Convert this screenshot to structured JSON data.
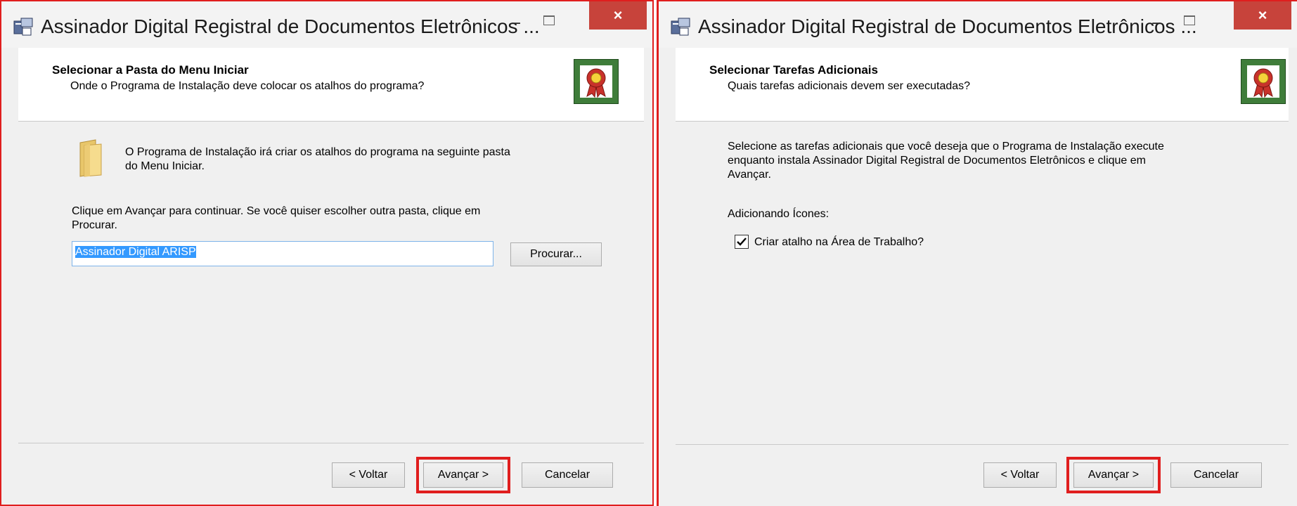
{
  "left_window": {
    "title": "Assinador Digital Registral de Documentos Eletrônicos ...",
    "controls": {
      "minimize": "−",
      "close": "×"
    },
    "header": {
      "title": "Selecionar a Pasta do Menu Iniciar",
      "subtitle": "Onde o Programa de Instalação deve colocar os atalhos do programa?"
    },
    "info_line1": "O Programa de Instalação irá criar os atalhos do programa na seguinte pasta",
    "info_line2": "do Menu Iniciar.",
    "instruction_line1": "Clique em Avançar para continuar. Se você quiser escolher outra pasta, clique em",
    "instruction_line2": "Procurar.",
    "folder_input_value": "Assinador Digital ARISP",
    "browse_label": "Procurar...",
    "back_label": "< Voltar",
    "next_label": "Avançar >",
    "cancel_label": "Cancelar"
  },
  "right_window": {
    "title": "Assinador Digital Registral de Documentos Eletrônicos ...",
    "controls": {
      "minimize": "−",
      "close": "×"
    },
    "header": {
      "title": "Selecionar Tarefas Adicionais",
      "subtitle": "Quais tarefas adicionais devem ser executadas?"
    },
    "desc_line1": "Selecione as tarefas adicionais que você deseja que o Programa de Instalação execute",
    "desc_line2": "enquanto instala Assinador Digital Registral de Documentos Eletrônicos e clique em",
    "desc_line3": "Avançar.",
    "group_label": "Adicionando Ícones:",
    "checkbox_label": "Criar atalho na Área de Trabalho?",
    "checkbox_checked": true,
    "back_label": "< Voltar",
    "next_label": "Avançar >",
    "cancel_label": "Cancelar"
  },
  "colors": {
    "highlight": "#e01e1e",
    "close_button": "#c7433b",
    "selection": "#3399ff",
    "award_green": "#3f7d3a"
  }
}
